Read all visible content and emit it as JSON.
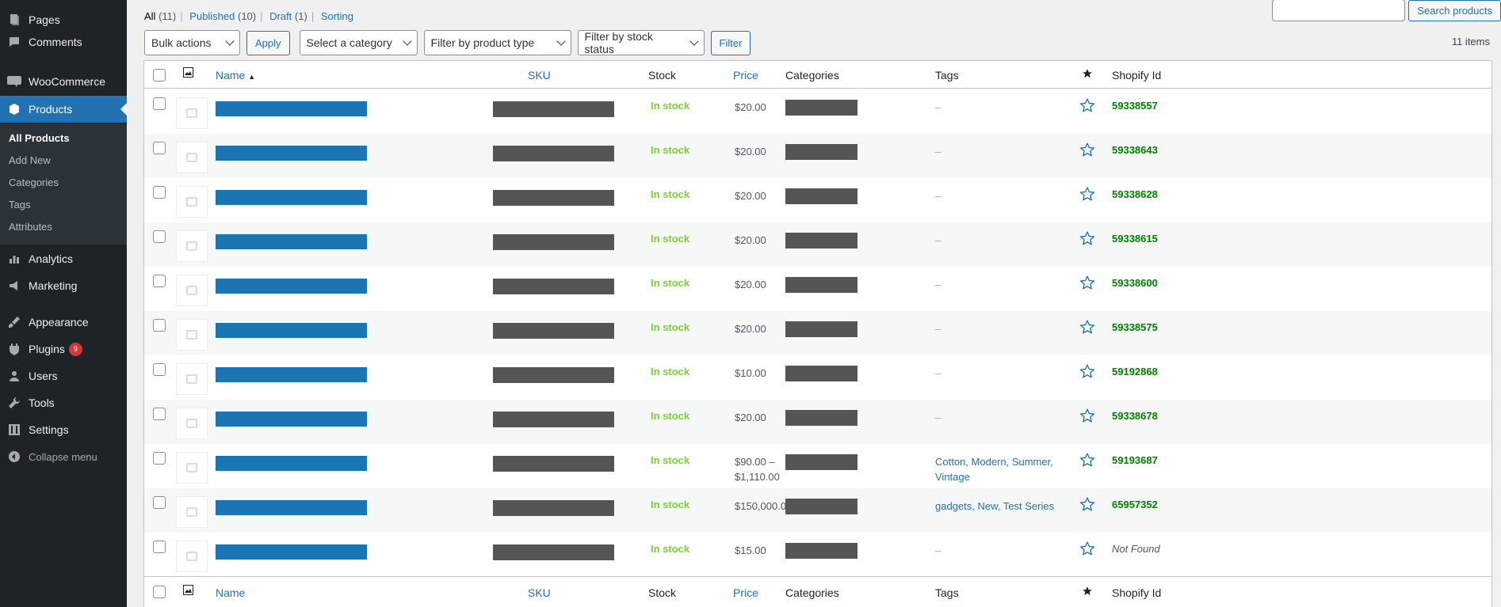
{
  "sidebar": {
    "items": [
      {
        "label": "Pages",
        "icon": "pages-icon"
      },
      {
        "label": "Comments",
        "icon": "comments-icon"
      },
      {
        "label": "WooCommerce",
        "icon": "woocommerce-icon"
      },
      {
        "label": "Products",
        "icon": "products-icon"
      },
      {
        "label": "Analytics",
        "icon": "analytics-icon"
      },
      {
        "label": "Marketing",
        "icon": "marketing-icon"
      },
      {
        "label": "Appearance",
        "icon": "appearance-icon"
      },
      {
        "label": "Plugins",
        "icon": "plugins-icon",
        "badge": "9"
      },
      {
        "label": "Users",
        "icon": "users-icon"
      },
      {
        "label": "Tools",
        "icon": "tools-icon"
      },
      {
        "label": "Settings",
        "icon": "settings-icon"
      },
      {
        "label": "Collapse menu",
        "icon": "collapse-icon"
      }
    ],
    "submenu": [
      "All Products",
      "Add New",
      "Categories",
      "Tags",
      "Attributes"
    ]
  },
  "views": {
    "all": "All",
    "all_count": "(11)",
    "published": "Published",
    "published_count": "(10)",
    "draft": "Draft",
    "draft_count": "(1)",
    "sorting": "Sorting"
  },
  "search": {
    "button": "Search products",
    "value": ""
  },
  "tablenav": {
    "bulk": "Bulk actions",
    "apply": "Apply",
    "category": "Select a category",
    "product_type": "Filter by product type",
    "stock_status": "Filter by stock status",
    "filter": "Filter",
    "items": "11 items"
  },
  "columns": {
    "name": "Name",
    "sku": "SKU",
    "stock": "Stock",
    "price": "Price",
    "categories": "Categories",
    "tags": "Tags",
    "shopify": "Shopify Id"
  },
  "rows": [
    {
      "stock": "In stock",
      "price": "$20.00",
      "tags": "–",
      "tags_link": false,
      "shopify": "59338557"
    },
    {
      "stock": "In stock",
      "price": "$20.00",
      "tags": "–",
      "tags_link": false,
      "shopify": "59338643"
    },
    {
      "stock": "In stock",
      "price": "$20.00",
      "tags": "–",
      "tags_link": false,
      "shopify": "59338628"
    },
    {
      "stock": "In stock",
      "price": "$20.00",
      "tags": "–",
      "tags_link": false,
      "shopify": "59338615"
    },
    {
      "stock": "In stock",
      "price": "$20.00",
      "tags": "–",
      "tags_link": false,
      "shopify": "59338600"
    },
    {
      "stock": "In stock",
      "price": "$20.00",
      "tags": "–",
      "tags_link": false,
      "shopify": "59338575"
    },
    {
      "stock": "In stock",
      "price": "$10.00",
      "tags": "–",
      "tags_link": false,
      "shopify": "59192868"
    },
    {
      "stock": "In stock",
      "price": "$20.00",
      "tags": "–",
      "tags_link": false,
      "shopify": "59338678"
    },
    {
      "stock": "In stock",
      "price": "$90.00 – $1,110.00",
      "tags": "Cotton, Modern, Summer, Vintage",
      "tags_link": true,
      "shopify": "59193687"
    },
    {
      "stock": "In stock",
      "price": "$150,000.00",
      "tags": "gadgets, New, Test Series",
      "tags_link": true,
      "shopify": "65957352"
    },
    {
      "stock": "In stock",
      "price": "$15.00",
      "tags": "–",
      "tags_link": false,
      "shopify": "Not Found",
      "not_found": true
    }
  ],
  "colors": {
    "accent": "#2271b1",
    "sidebar": "#1d2327",
    "in_stock": "#7ad03a",
    "shopify_id": "#008000"
  }
}
